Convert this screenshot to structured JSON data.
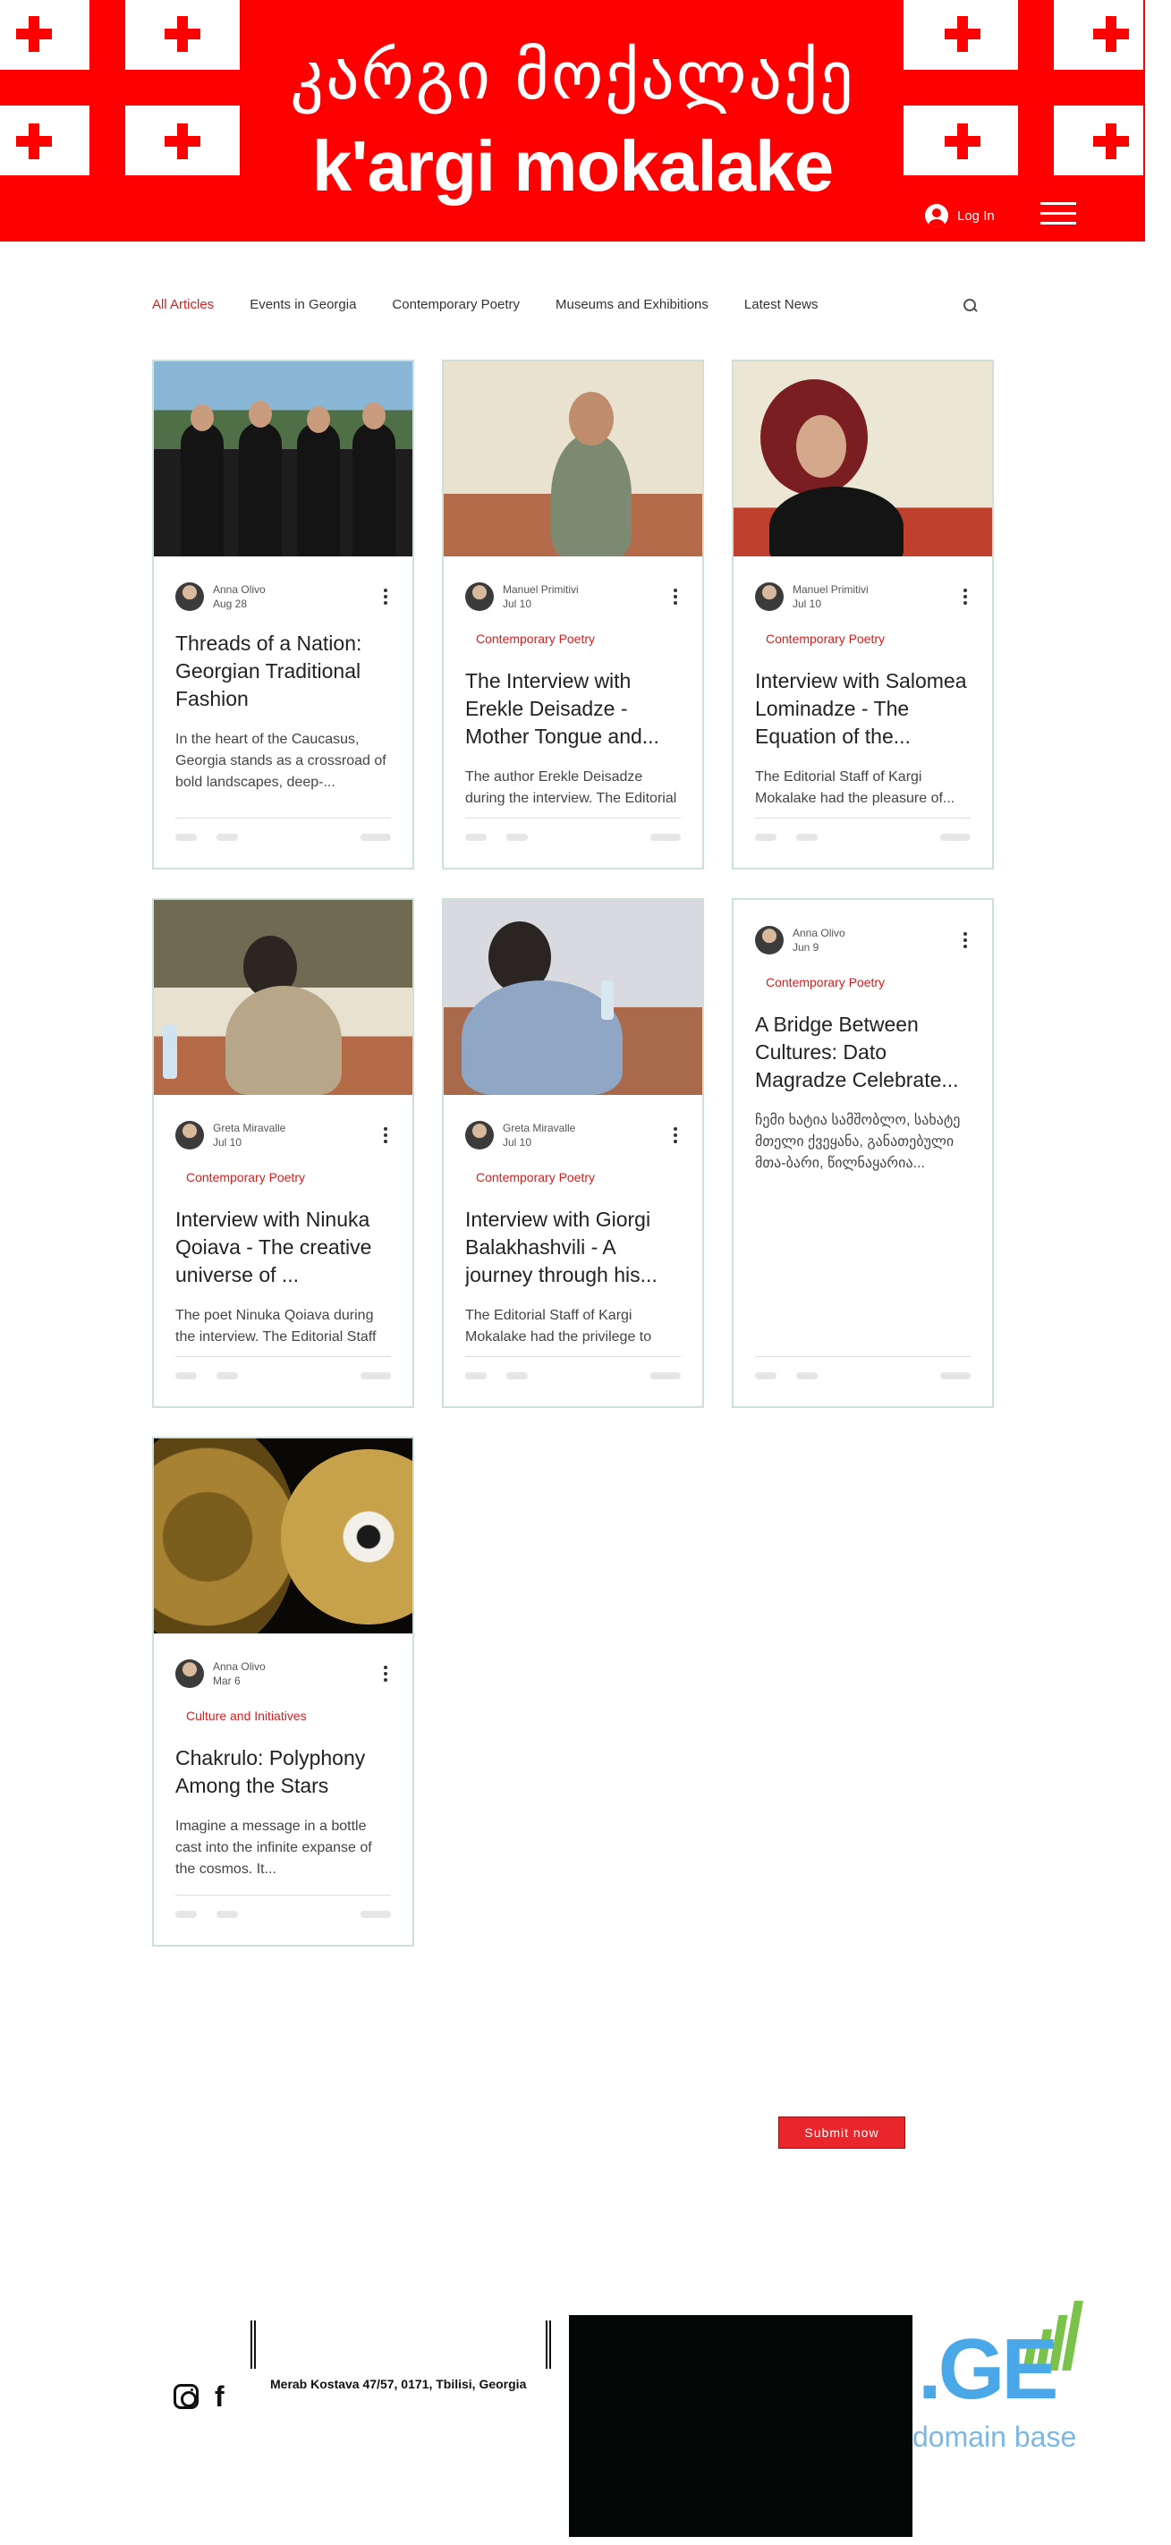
{
  "header": {
    "title_georgian": "კარგი მოქალაქე",
    "title_latin": "k'argi mokalake",
    "login_label": "Log In"
  },
  "nav": {
    "items": [
      "All Articles",
      "Events in Georgia",
      "Contemporary Poetry",
      "Museums and Exhibitions",
      "Latest News"
    ]
  },
  "posts": [
    {
      "author": "Anna Olivo",
      "date": "Aug 28",
      "category": "",
      "title": "Threads of a Nation: Georgian Traditional Fashion",
      "excerpt": "In the heart of the Caucasus, Georgia stands as a crossroad of bold landscapes, deep-..."
    },
    {
      "author": "Manuel Primitivi",
      "date": "Jul 10",
      "category": "Contemporary Poetry",
      "title": "The Interview with Erekle Deisadze - Mother Tongue and...",
      "excerpt": "The author Erekle Deisadze during the interview. The Editorial Staff of Kargi..."
    },
    {
      "author": "Manuel Primitivi",
      "date": "Jul 10",
      "category": "Contemporary Poetry",
      "title": "Interview with Salomea Lominadze - The Equation of the...",
      "excerpt": "The Editorial Staff of Kargi Mokalake had the pleasure of..."
    },
    {
      "author": "Greta Miravalle",
      "date": "Jul 10",
      "category": "Contemporary Poetry",
      "title": "Interview with Ninuka Qoiava - The creative universe of ...",
      "excerpt": "The poet Ninuka Qoiava during the interview. The Editorial Staff of Kargi..."
    },
    {
      "author": "Greta Miravalle",
      "date": "Jul 10",
      "category": "Contemporary Poetry",
      "title": "Interview with Giorgi Balakhashvili - A journey through his...",
      "excerpt": "The Editorial Staff of Kargi Mokalake had the privilege to interview Giorgi Balakhashvili..."
    },
    {
      "author": "Anna Olivo",
      "date": "Jun 9",
      "category": "Contemporary Poetry",
      "title": "A Bridge Between Cultures: Dato Magradze Celebrate...",
      "excerpt": "ჩემი ხატია სამშობლო, სახატე მთელი ქვეყანა, განათებული მთა-ბარი, წილნაყარია..."
    },
    {
      "author": "Anna Olivo",
      "date": "Mar 6",
      "category": "Culture and Initiatives",
      "title": "Chakrulo: Polyphony Among the Stars",
      "excerpt": "Imagine a message in a bottle cast into the infinite expanse of the cosmos. It..."
    }
  ],
  "submit_label": "Submit now",
  "footer": {
    "address": "Merab Kostava 47/57, 0171, Tbilisi, Georgia",
    "logo_text": ".GE",
    "logo_caption": "domain base"
  },
  "colors": {
    "brand_red": "#ff0000",
    "category_red": "#d41f1f",
    "ge_blue": "#4aa8e8",
    "ge_green": "#7ac24a"
  }
}
